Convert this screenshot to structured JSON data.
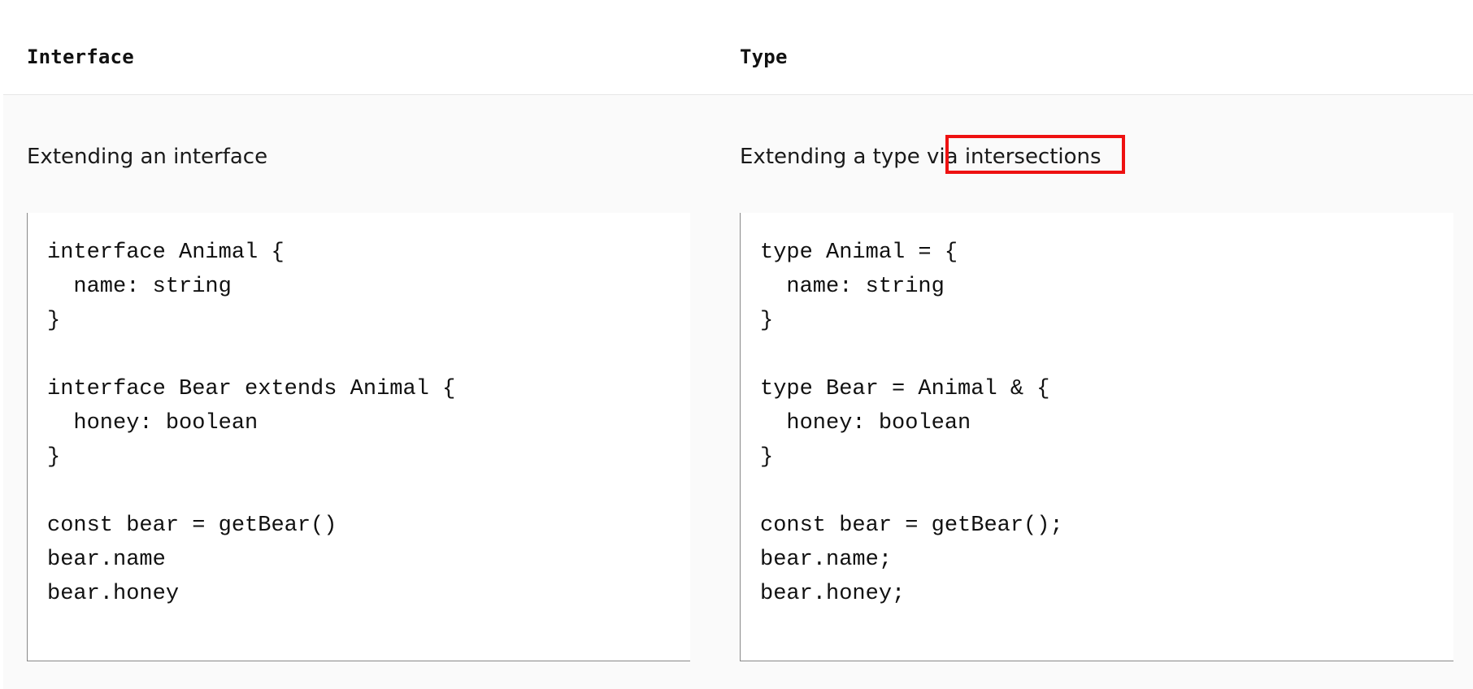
{
  "headers": {
    "left": "Interface",
    "right": "Type"
  },
  "left": {
    "description": "Extending an interface",
    "code": [
      "interface Animal {",
      "  name: string",
      "}",
      "",
      "interface Bear extends Animal {",
      "  honey: boolean",
      "}",
      "",
      "const bear = getBear()",
      "bear.name",
      "bear.honey"
    ]
  },
  "right": {
    "description_prefix": "Extending a type via ",
    "description_highlight": "intersections",
    "code": [
      "type Animal = {",
      "  name: string",
      "}",
      "",
      "type Bear = Animal & {",
      "  honey: boolean",
      "}",
      "",
      "const bear = getBear();",
      "bear.name;",
      "bear.honey;"
    ]
  },
  "colors": {
    "highlight": "#ee1111"
  }
}
